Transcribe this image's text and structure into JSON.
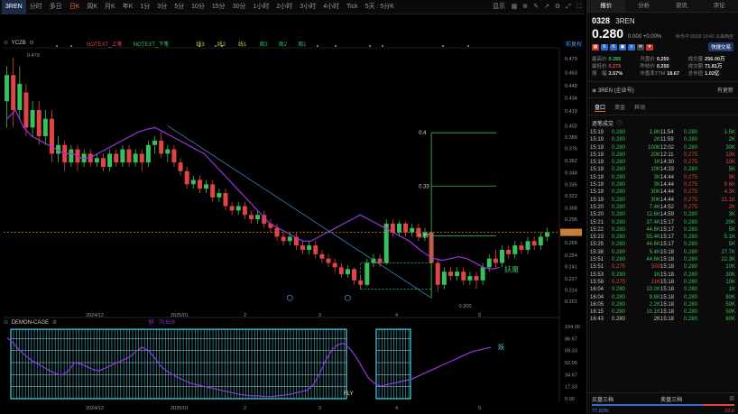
{
  "toolbar": {
    "symbol": "3REN",
    "items": [
      "分时",
      "多日",
      "日K",
      "周K",
      "月K",
      "年K",
      "1分",
      "3分",
      "5分",
      "10分",
      "15分",
      "30分",
      "1小时",
      "2小时",
      "3小时",
      "4小时",
      "Tick",
      "5天 : 5分K"
    ],
    "active_index": 2,
    "right_label": "显示"
  },
  "legend": {
    "main_name": "YCZB",
    "main_items": [
      {
        "text": "NOTEXT_上笔",
        "color": "#e04545"
      },
      {
        "text": "NOTEXT_下笔",
        "color": "#3ac05a"
      },
      {
        "text": "线3",
        "color": "#d8c33a"
      },
      {
        "text": "线2",
        "color": "#d8c33a"
      },
      {
        "text": "线1",
        "color": "#d8c33a"
      },
      {
        "text": "周3",
        "color": "#3ac05a"
      },
      {
        "text": "周2",
        "color": "#3ac05a"
      },
      {
        "text": "周1",
        "color": "#3ac05a"
      }
    ],
    "right_label": "前复权",
    "sub_name": "DEMON-CAGE",
    "sub_value_label": "妖",
    "sub_value": "70.619"
  },
  "chart_data": [
    {
      "type": "candlestick",
      "title": "",
      "y_ticks": [
        0.479,
        0.463,
        0.448,
        0.434,
        0.419,
        0.402,
        0.389,
        0.376,
        0.362,
        0.348,
        0.335,
        0.322,
        0.308,
        0.295,
        0.28,
        0.268,
        0.254,
        0.241,
        0.227,
        0.214,
        0.201
      ],
      "ylim": [
        0.196,
        0.485
      ],
      "x_labels": [
        "2024/12",
        "2025/01",
        "2",
        "3",
        "4",
        "5"
      ],
      "top_value_label": "0.479",
      "low_value_label": "0.200",
      "current_price": 0.28,
      "fib_levels": [
        {
          "label": "0.4",
          "value": 0.394
        },
        {
          "label": "0.33",
          "value": 0.333
        },
        {
          "label": "0.27",
          "value": 0.276
        }
      ],
      "annotation": "妖魔",
      "candles": [
        [
          0.43,
          0.46,
          0.4,
          0.47
        ],
        [
          0.46,
          0.42,
          0.4,
          0.48
        ],
        [
          0.42,
          0.45,
          0.41,
          0.47
        ],
        [
          0.44,
          0.4,
          0.39,
          0.45
        ],
        [
          0.4,
          0.42,
          0.39,
          0.43
        ],
        [
          0.42,
          0.39,
          0.38,
          0.43
        ],
        [
          0.39,
          0.41,
          0.38,
          0.42
        ],
        [
          0.41,
          0.37,
          0.36,
          0.42
        ],
        [
          0.37,
          0.38,
          0.36,
          0.39
        ],
        [
          0.38,
          0.36,
          0.35,
          0.385
        ],
        [
          0.36,
          0.375,
          0.355,
          0.38
        ],
        [
          0.375,
          0.36,
          0.35,
          0.38
        ],
        [
          0.36,
          0.37,
          0.355,
          0.375
        ],
        [
          0.37,
          0.36,
          0.355,
          0.375
        ],
        [
          0.36,
          0.365,
          0.355,
          0.37
        ],
        [
          0.365,
          0.355,
          0.35,
          0.37
        ],
        [
          0.355,
          0.37,
          0.35,
          0.375
        ],
        [
          0.37,
          0.36,
          0.355,
          0.375
        ],
        [
          0.36,
          0.375,
          0.355,
          0.38
        ],
        [
          0.375,
          0.36,
          0.355,
          0.38
        ],
        [
          0.36,
          0.37,
          0.355,
          0.375
        ],
        [
          0.37,
          0.36,
          0.35,
          0.375
        ],
        [
          0.36,
          0.38,
          0.355,
          0.385
        ],
        [
          0.38,
          0.385,
          0.37,
          0.39
        ],
        [
          0.385,
          0.37,
          0.365,
          0.395
        ],
        [
          0.37,
          0.375,
          0.36,
          0.38
        ],
        [
          0.375,
          0.36,
          0.355,
          0.38
        ],
        [
          0.36,
          0.35,
          0.345,
          0.365
        ],
        [
          0.35,
          0.335,
          0.33,
          0.355
        ],
        [
          0.335,
          0.34,
          0.33,
          0.345
        ],
        [
          0.34,
          0.33,
          0.325,
          0.345
        ],
        [
          0.33,
          0.335,
          0.325,
          0.34
        ],
        [
          0.335,
          0.32,
          0.315,
          0.34
        ],
        [
          0.32,
          0.325,
          0.315,
          0.33
        ],
        [
          0.325,
          0.31,
          0.305,
          0.33
        ],
        [
          0.31,
          0.305,
          0.3,
          0.315
        ],
        [
          0.305,
          0.31,
          0.3,
          0.315
        ],
        [
          0.31,
          0.3,
          0.295,
          0.315
        ],
        [
          0.3,
          0.295,
          0.29,
          0.305
        ],
        [
          0.295,
          0.3,
          0.29,
          0.305
        ],
        [
          0.3,
          0.29,
          0.285,
          0.305
        ],
        [
          0.29,
          0.285,
          0.28,
          0.295
        ],
        [
          0.285,
          0.275,
          0.27,
          0.29
        ],
        [
          0.275,
          0.27,
          0.265,
          0.28
        ],
        [
          0.27,
          0.275,
          0.265,
          0.28
        ],
        [
          0.275,
          0.265,
          0.26,
          0.28
        ],
        [
          0.265,
          0.26,
          0.255,
          0.27
        ],
        [
          0.26,
          0.265,
          0.255,
          0.27
        ],
        [
          0.265,
          0.255,
          0.25,
          0.27
        ],
        [
          0.255,
          0.25,
          0.245,
          0.26
        ],
        [
          0.25,
          0.245,
          0.24,
          0.255
        ],
        [
          0.245,
          0.24,
          0.235,
          0.25
        ],
        [
          0.24,
          0.232,
          0.228,
          0.245
        ],
        [
          0.232,
          0.238,
          0.228,
          0.242
        ],
        [
          0.238,
          0.225,
          0.22,
          0.24
        ],
        [
          0.225,
          0.22,
          0.215,
          0.23
        ],
        [
          0.22,
          0.245,
          0.218,
          0.25
        ],
        [
          0.245,
          0.25,
          0.24,
          0.255
        ],
        [
          0.25,
          0.245,
          0.24,
          0.255
        ],
        [
          0.245,
          0.29,
          0.243,
          0.295
        ],
        [
          0.29,
          0.28,
          0.275,
          0.295
        ],
        [
          0.28,
          0.29,
          0.275,
          0.293
        ],
        [
          0.29,
          0.28,
          0.275,
          0.292
        ],
        [
          0.28,
          0.285,
          0.275,
          0.29
        ],
        [
          0.285,
          0.275,
          0.27,
          0.29
        ],
        [
          0.275,
          0.28,
          0.27,
          0.285
        ],
        [
          0.28,
          0.245,
          0.24,
          0.283
        ],
        [
          0.245,
          0.22,
          0.212,
          0.25
        ],
        [
          0.22,
          0.235,
          0.215,
          0.24
        ],
        [
          0.235,
          0.23,
          0.225,
          0.24
        ],
        [
          0.23,
          0.235,
          0.225,
          0.24
        ],
        [
          0.235,
          0.225,
          0.22,
          0.24
        ],
        [
          0.225,
          0.23,
          0.22,
          0.235
        ],
        [
          0.23,
          0.225,
          0.215,
          0.235
        ],
        [
          0.225,
          0.24,
          0.22,
          0.245
        ],
        [
          0.24,
          0.25,
          0.235,
          0.255
        ],
        [
          0.25,
          0.245,
          0.24,
          0.26
        ],
        [
          0.245,
          0.26,
          0.24,
          0.265
        ],
        [
          0.26,
          0.255,
          0.25,
          0.265
        ],
        [
          0.255,
          0.265,
          0.25,
          0.27
        ],
        [
          0.265,
          0.26,
          0.255,
          0.27
        ],
        [
          0.26,
          0.27,
          0.255,
          0.275
        ],
        [
          0.27,
          0.265,
          0.26,
          0.275
        ],
        [
          0.265,
          0.275,
          0.26,
          0.28
        ],
        [
          0.275,
          0.28,
          0.27,
          0.285
        ]
      ],
      "ma_line": [
        0.41,
        0.42,
        0.4,
        0.39,
        0.385,
        0.38,
        0.375,
        0.37,
        0.37,
        0.365,
        0.365,
        0.37,
        0.375,
        0.38,
        0.385,
        0.39,
        0.395,
        0.398,
        0.4,
        0.395,
        0.39,
        0.385,
        0.38,
        0.375,
        0.37,
        0.36,
        0.35,
        0.34,
        0.33,
        0.32,
        0.31,
        0.3,
        0.29,
        0.285,
        0.28,
        0.275,
        0.27,
        0.27,
        0.275,
        0.28,
        0.285,
        0.29,
        0.295,
        0.3,
        0.295,
        0.29,
        0.285,
        0.28,
        0.275,
        0.27,
        0.262,
        0.255,
        0.25,
        0.248,
        0.25,
        0.252,
        0.25,
        0.245,
        0.24,
        0.238,
        0.24
      ]
    },
    {
      "type": "line",
      "title": "DEMON-CAGE",
      "y_ticks": [
        104.0,
        86.67,
        69.33,
        52.0,
        34.67,
        17.33,
        0.0
      ],
      "ylim": [
        0,
        104
      ],
      "end_label": "妖",
      "marker_label": "FLY",
      "series_values": [
        88,
        80,
        70,
        62,
        55,
        50,
        45,
        40,
        36,
        34,
        40,
        52,
        50,
        46,
        42,
        40,
        44,
        48,
        52,
        56,
        60,
        68,
        74,
        70,
        60,
        48,
        40,
        35,
        30,
        26,
        22,
        20,
        18,
        16,
        14,
        12,
        10,
        8,
        6,
        5,
        4,
        4,
        3,
        3,
        4,
        5,
        6,
        8,
        10,
        12,
        20,
        35,
        55,
        70,
        78,
        80,
        72,
        60,
        45,
        30,
        22,
        18,
        20,
        22,
        24,
        26,
        28,
        32,
        36,
        40,
        44,
        48,
        52,
        56,
        60,
        64,
        68,
        70,
        72,
        74
      ]
    }
  ],
  "panel": {
    "tabs": [
      "报价",
      "分析",
      "资讯",
      "评论"
    ],
    "code": "0328",
    "name": "3REN",
    "price": "0.280",
    "change": "0.000 +0.00%",
    "time": "休市中 05/09 16:43 马来西亚",
    "quick_trade": "快捷交易",
    "stats": [
      {
        "label": "最高价",
        "value": "0.285",
        "cls": "up"
      },
      {
        "label": "开盘价",
        "value": "0.250",
        "cls": ""
      },
      {
        "label": "成交量",
        "value": "256.00万",
        "cls": ""
      },
      {
        "label": "最低价",
        "value": "0.275",
        "cls": "dn"
      },
      {
        "label": "昨收价",
        "value": "0.250",
        "cls": ""
      },
      {
        "label": "成交额",
        "value": "71.81万",
        "cls": ""
      },
      {
        "label": "振　幅",
        "value": "3.57%",
        "cls": ""
      },
      {
        "label": "市盈率TTM",
        "value": "18.67",
        "cls": ""
      },
      {
        "label": "总市值",
        "value": "1.02亿",
        "cls": ""
      }
    ],
    "company": "3REN (企业号)",
    "company_more": "有更新",
    "sub_tabs": [
      "盘口",
      "资金",
      "异动"
    ],
    "ticks_title": "逐笔成交",
    "ticks": [
      [
        "15:19",
        "0.280",
        "1.9K",
        "11:54",
        "0.280",
        "1.5K",
        "up",
        "up"
      ],
      [
        "15:19",
        "0.280",
        "2K",
        "11:59",
        "0.280",
        "2K",
        "up",
        "up"
      ],
      [
        "15:19",
        "0.280",
        "100K",
        "12:02",
        "0.280",
        "30K",
        "up",
        "up"
      ],
      [
        "15:19",
        "0.280",
        "20K",
        "12:11",
        "0.275",
        "10K",
        "up",
        "dn"
      ],
      [
        "15:19",
        "0.280",
        "1K",
        "14:30",
        "0.275",
        "10K",
        "up",
        "dn"
      ],
      [
        "15:19",
        "0.280",
        "10K",
        "14:33",
        "0.280",
        "5K",
        "up",
        "up"
      ],
      [
        "15:19",
        "0.280",
        "3K",
        "14:44",
        "0.275",
        "9K",
        "up",
        "dn"
      ],
      [
        "15:19",
        "0.280",
        "3K",
        "14:44",
        "0.275",
        "9.6K",
        "up",
        "dn"
      ],
      [
        "15:19",
        "0.280",
        "30K",
        "14:44",
        "0.275",
        "4.3K",
        "up",
        "dn"
      ],
      [
        "15:19",
        "0.280",
        "30K",
        "14:44",
        "0.275",
        "21.1K",
        "up",
        "dn"
      ],
      [
        "15:20",
        "0.280",
        "7.4K",
        "14:52",
        "0.275",
        "2K",
        "up",
        "dn"
      ],
      [
        "15:20",
        "0.280",
        "12.6K",
        "14:59",
        "0.280",
        "3K",
        "up",
        "up"
      ],
      [
        "15:21",
        "0.280",
        "37.4K",
        "15:17",
        "0.280",
        "20K",
        "up",
        "up"
      ],
      [
        "15:22",
        "0.280",
        "44.6K",
        "15:17",
        "0.280",
        "5K",
        "up",
        "up"
      ],
      [
        "15:23",
        "0.280",
        "55.4K",
        "15:17",
        "0.280",
        "5.1K",
        "up",
        "up"
      ],
      [
        "15:25",
        "0.280",
        "44.6K",
        "15:17",
        "0.280",
        "5K",
        "up",
        "up"
      ],
      [
        "15:38",
        "0.280",
        "5.4K",
        "15:18",
        "0.280",
        "27.7K",
        "up",
        "up"
      ],
      [
        "15:51",
        "0.280",
        "44.6K",
        "15:18",
        "0.280",
        "22.3K",
        "up",
        "up"
      ],
      [
        "15:51",
        "0.275",
        "500",
        "15:18",
        "0.280",
        "10K",
        "dn",
        "up"
      ],
      [
        "15:53",
        "0.280",
        "1K",
        "15:18",
        "0.280",
        "30K",
        "up",
        "up"
      ],
      [
        "15:58",
        "0.275",
        "11K",
        "15:18",
        "0.280",
        "10K",
        "dn",
        "up"
      ],
      [
        "16:04",
        "0.280",
        "10.2K",
        "15:18",
        "0.280",
        "1K",
        "up",
        "up"
      ],
      [
        "16:04",
        "0.280",
        "9.8K",
        "15:18",
        "0.280",
        "80K",
        "up",
        "up"
      ],
      [
        "16:05",
        "0.280",
        "2.2K",
        "15:18",
        "0.280",
        "50K",
        "up",
        "up"
      ],
      [
        "16:15",
        "0.280",
        "10.1K",
        "15:18",
        "0.280",
        "50K",
        "up",
        "up"
      ],
      [
        "16:43",
        "0.280",
        "2K",
        "15:18",
        "0.280",
        "60K",
        "nt",
        "up"
      ]
    ],
    "bottom": {
      "buy_label": "买盘三档",
      "sell_label": "卖盘三档",
      "buy_pct": "77.93%",
      "sell_pct": "22.0"
    }
  },
  "colors": {
    "up": "#3ac05a",
    "down": "#e04545",
    "purple": "#9b33e0",
    "cyan": "#45d5e5",
    "price_line": "#d07a2a",
    "trend": "#3f7fbf"
  }
}
